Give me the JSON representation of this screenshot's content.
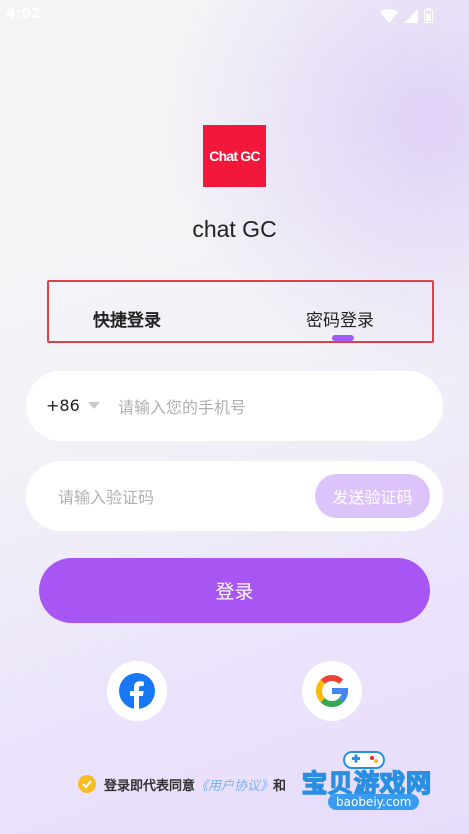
{
  "status_bar": {
    "time": "4:02"
  },
  "app": {
    "logo_text": "Chat GC",
    "name": "chat GC"
  },
  "tabs": {
    "quick_login": "快捷登录",
    "password_login": "密码登录"
  },
  "phone": {
    "country_code": "+86",
    "placeholder": "请输入您的手机号"
  },
  "code": {
    "placeholder": "请输入验证码",
    "send_label": "发送验证码"
  },
  "login_button": "登录",
  "social": {
    "facebook": "facebook-icon",
    "google": "google-icon"
  },
  "agreement": {
    "prefix": "登录即代表同意",
    "user_agreement": "《用户协议》",
    "conjunction": "和"
  },
  "watermark": {
    "text": "宝贝游戏网",
    "url": "baobeiy.com"
  },
  "colors": {
    "accent": "#a756f4",
    "send_code_bg": "#dcc4fb",
    "logo_bg": "#f1183b",
    "tab_border": "#d9444c",
    "check": "#f8bd22"
  }
}
